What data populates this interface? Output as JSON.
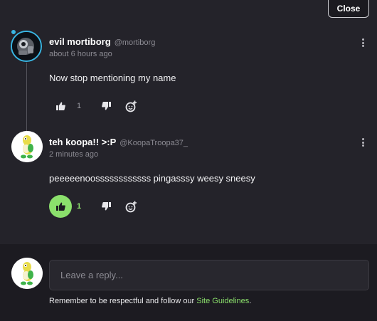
{
  "header": {
    "close_label": "Close"
  },
  "comments": [
    {
      "author": "evil mortiborg",
      "handle": "@mortiborg",
      "time": "about 6 hours ago",
      "text": "Now stop mentioning my name",
      "likes": "1",
      "avatar": "robot-avatar"
    },
    {
      "author": "teh koopa!! >:P",
      "handle": "@KoopaTroopa37_",
      "time": "2 minutes ago",
      "text": "peeeeenoossssssssssss pingasssy weesy sneesy",
      "likes": "1",
      "liked": true,
      "avatar": "koopa-avatar"
    }
  ],
  "reply": {
    "placeholder": "Leave a reply...",
    "guidelines_prefix": "Remember to be respectful and follow our ",
    "guidelines_link": "Site Guidelines",
    "guidelines_suffix": "."
  },
  "colors": {
    "accent": "#8be06c",
    "background": "#24232a",
    "reply_bg": "#1c1b21",
    "avatar_ring": "#39b6e3"
  }
}
